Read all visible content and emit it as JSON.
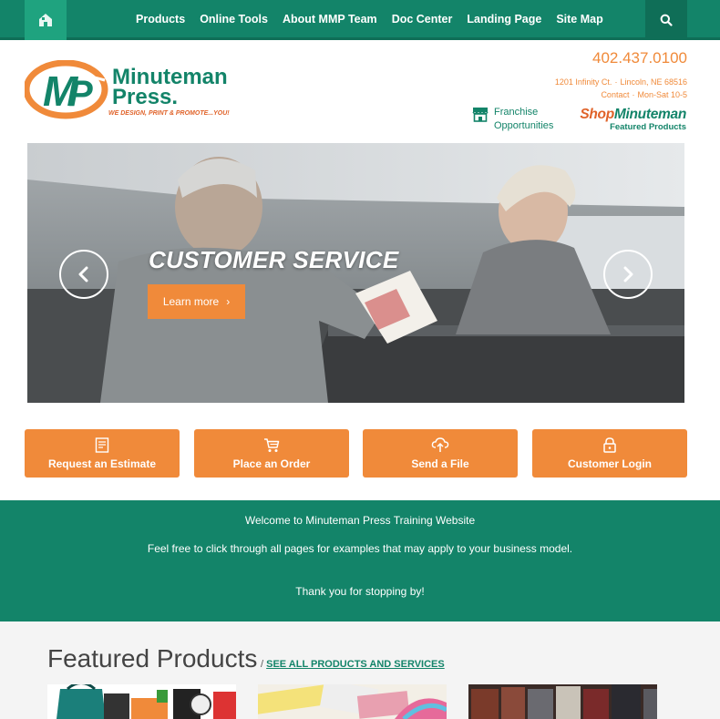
{
  "nav": {
    "items": [
      "Products",
      "Online Tools",
      "About MMP Team",
      "Doc Center",
      "Landing Page",
      "Site Map"
    ]
  },
  "header": {
    "logo_line1": "Minuteman",
    "logo_line2": "Press.",
    "logo_tagline": "WE DESIGN, PRINT & PROMOTE...YOU!",
    "phone": "402.437.0100",
    "address": "1201 Infinity Ct.",
    "city": "Lincoln, NE 68516",
    "contact": "Contact",
    "hours": "Mon-Sat 10-5",
    "franchise_line1": "Franchise",
    "franchise_line2": "Opportunities",
    "shop_part1": "Shop",
    "shop_part2": "Minuteman",
    "shop_sub": "Featured Products"
  },
  "hero": {
    "title": "CUSTOMER SERVICE",
    "button": "Learn more"
  },
  "actions": [
    "Request an Estimate",
    "Place an Order",
    "Send a File",
    "Customer Login"
  ],
  "welcome": {
    "line1": "Welcome to Minuteman Press Training Website",
    "line2": "Feel free to click through all pages for examples that may apply to your business model.",
    "line3": "Thank you for stopping by!"
  },
  "featured": {
    "title": "Featured Products",
    "separator": "/",
    "link": "SEE ALL PRODUCTS AND SERVICES"
  },
  "colors": {
    "brand_green": "#138469",
    "accent_orange": "#f08a3a"
  }
}
